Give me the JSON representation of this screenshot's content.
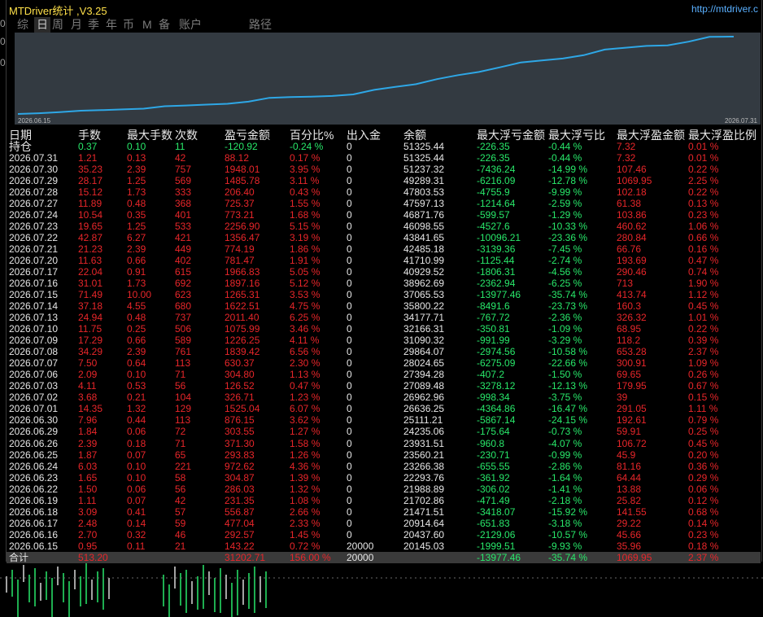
{
  "app": {
    "title": "MTDriver统计 ,V3.25",
    "url": "http://mtdriver.c"
  },
  "tabs": [
    {
      "label": "综",
      "active": false
    },
    {
      "label": "日",
      "active": true
    },
    {
      "label": "周",
      "active": false
    },
    {
      "label": "月",
      "active": false
    },
    {
      "label": "季",
      "active": false
    },
    {
      "label": "年",
      "active": false
    },
    {
      "label": "币",
      "active": false
    },
    {
      "label": "M",
      "active": false
    },
    {
      "label": "备",
      "active": false
    },
    {
      "label": "账户",
      "active": false
    },
    {
      "label": "路径",
      "active": false
    }
  ],
  "equity_chart": {
    "start_label": "2026.06.15",
    "end_label": "2026.07.31",
    "line_color": "#2ea7e6",
    "values": [
      20145.03,
      20437.6,
      20914.64,
      21471.51,
      21702.86,
      21988.89,
      22293.76,
      23266.38,
      23560.21,
      23931.51,
      24235.06,
      25111.21,
      26636.25,
      26962.96,
      27089.48,
      27394.28,
      28024.65,
      29864.07,
      31090.32,
      32166.31,
      34177.71,
      35800.22,
      37065.53,
      38962.69,
      40929.52,
      41710.99,
      42485.18,
      43841.65,
      46098.55,
      46871.76,
      47597.13,
      47803.53,
      49289.31,
      51237.32,
      51325.44
    ]
  },
  "columns": [
    "日期",
    "手数",
    "最大手数",
    "次数",
    "盈亏金额",
    "百分比%",
    "出入金",
    "余额",
    "最大浮亏金额",
    "最大浮亏比",
    "最大浮盈金额",
    "最大浮盈比例"
  ],
  "holding": {
    "date": "持仓",
    "lots": "0.37",
    "max_lots": "0.10",
    "count": "11",
    "pnl": "-120.92",
    "pct": "-0.24 %",
    "inout": "0",
    "balance": "51325.44",
    "max_dd": "-226.35",
    "max_dd_pct": "-0.44 %",
    "max_fp": "7.32",
    "max_fp_pct": "0.01 %"
  },
  "rows": [
    {
      "date": "2026.07.31",
      "lots": "1.21",
      "max_lots": "0.13",
      "count": "42",
      "pnl": "88.12",
      "pct": "0.17 %",
      "inout": "0",
      "balance": "51325.44",
      "max_dd": "-226.35",
      "max_dd_pct": "-0.44 %",
      "max_fp": "7.32",
      "max_fp_pct": "0.01 %"
    },
    {
      "date": "2026.07.30",
      "lots": "35.23",
      "max_lots": "2.39",
      "count": "757",
      "pnl": "1948.01",
      "pct": "3.95 %",
      "inout": "0",
      "balance": "51237.32",
      "max_dd": "-7436.24",
      "max_dd_pct": "-14.99 %",
      "max_fp": "107.46",
      "max_fp_pct": "0.22 %"
    },
    {
      "date": "2026.07.29",
      "lots": "28.17",
      "max_lots": "1.25",
      "count": "569",
      "pnl": "1485.78",
      "pct": "3.11 %",
      "inout": "0",
      "balance": "49289.31",
      "max_dd": "-6216.09",
      "max_dd_pct": "-12.78 %",
      "max_fp": "1069.95",
      "max_fp_pct": "2.25 %"
    },
    {
      "date": "2026.07.28",
      "lots": "15.12",
      "max_lots": "1.73",
      "count": "333",
      "pnl": "206.40",
      "pct": "0.43 %",
      "inout": "0",
      "balance": "47803.53",
      "max_dd": "-4755.9",
      "max_dd_pct": "-9.99 %",
      "max_fp": "102.18",
      "max_fp_pct": "0.22 %"
    },
    {
      "date": "2026.07.27",
      "lots": "11.89",
      "max_lots": "0.48",
      "count": "368",
      "pnl": "725.37",
      "pct": "1.55 %",
      "inout": "0",
      "balance": "47597.13",
      "max_dd": "-1214.64",
      "max_dd_pct": "-2.59 %",
      "max_fp": "61.38",
      "max_fp_pct": "0.13 %"
    },
    {
      "date": "2026.07.24",
      "lots": "10.54",
      "max_lots": "0.35",
      "count": "401",
      "pnl": "773.21",
      "pct": "1.68 %",
      "inout": "0",
      "balance": "46871.76",
      "max_dd": "-599.57",
      "max_dd_pct": "-1.29 %",
      "max_fp": "103.86",
      "max_fp_pct": "0.23 %"
    },
    {
      "date": "2026.07.23",
      "lots": "19.65",
      "max_lots": "1.25",
      "count": "533",
      "pnl": "2256.90",
      "pct": "5.15 %",
      "inout": "0",
      "balance": "46098.55",
      "max_dd": "-4527.6",
      "max_dd_pct": "-10.33 %",
      "max_fp": "460.62",
      "max_fp_pct": "1.06 %"
    },
    {
      "date": "2026.07.22",
      "lots": "42.87",
      "max_lots": "6.27",
      "count": "421",
      "pnl": "1356.47",
      "pct": "3.19 %",
      "inout": "0",
      "balance": "43841.65",
      "max_dd": "-10096.21",
      "max_dd_pct": "-23.36 %",
      "max_fp": "280.84",
      "max_fp_pct": "0.66 %"
    },
    {
      "date": "2026.07.21",
      "lots": "21.23",
      "max_lots": "2.39",
      "count": "449",
      "pnl": "774.19",
      "pct": "1.86 %",
      "inout": "0",
      "balance": "42485.18",
      "max_dd": "-3139.36",
      "max_dd_pct": "-7.45 %",
      "max_fp": "66.76",
      "max_fp_pct": "0.16 %"
    },
    {
      "date": "2026.07.20",
      "lots": "11.63",
      "max_lots": "0.66",
      "count": "402",
      "pnl": "781.47",
      "pct": "1.91 %",
      "inout": "0",
      "balance": "41710.99",
      "max_dd": "-1125.44",
      "max_dd_pct": "-2.74 %",
      "max_fp": "193.69",
      "max_fp_pct": "0.47 %"
    },
    {
      "date": "2026.07.17",
      "lots": "22.04",
      "max_lots": "0.91",
      "count": "615",
      "pnl": "1966.83",
      "pct": "5.05 %",
      "inout": "0",
      "balance": "40929.52",
      "max_dd": "-1806.31",
      "max_dd_pct": "-4.56 %",
      "max_fp": "290.46",
      "max_fp_pct": "0.74 %"
    },
    {
      "date": "2026.07.16",
      "lots": "31.01",
      "max_lots": "1.73",
      "count": "692",
      "pnl": "1897.16",
      "pct": "5.12 %",
      "inout": "0",
      "balance": "38962.69",
      "max_dd": "-2362.94",
      "max_dd_pct": "-6.25 %",
      "max_fp": "713",
      "max_fp_pct": "1.90 %"
    },
    {
      "date": "2026.07.15",
      "lots": "71.49",
      "max_lots": "10.00",
      "count": "623",
      "pnl": "1265.31",
      "pct": "3.53 %",
      "inout": "0",
      "balance": "37065.53",
      "max_dd": "-13977.46",
      "max_dd_pct": "-35.74 %",
      "max_fp": "413.74",
      "max_fp_pct": "1.12 %"
    },
    {
      "date": "2026.07.14",
      "lots": "37.18",
      "max_lots": "4.55",
      "count": "680",
      "pnl": "1622.51",
      "pct": "4.75 %",
      "inout": "0",
      "balance": "35800.22",
      "max_dd": "-8491.6",
      "max_dd_pct": "-23.73 %",
      "max_fp": "160.3",
      "max_fp_pct": "0.45 %"
    },
    {
      "date": "2026.07.13",
      "lots": "24.94",
      "max_lots": "0.48",
      "count": "737",
      "pnl": "2011.40",
      "pct": "6.25 %",
      "inout": "0",
      "balance": "34177.71",
      "max_dd": "-767.72",
      "max_dd_pct": "-2.36 %",
      "max_fp": "326.32",
      "max_fp_pct": "1.01 %"
    },
    {
      "date": "2026.07.10",
      "lots": "11.75",
      "max_lots": "0.25",
      "count": "506",
      "pnl": "1075.99",
      "pct": "3.46 %",
      "inout": "0",
      "balance": "32166.31",
      "max_dd": "-350.81",
      "max_dd_pct": "-1.09 %",
      "max_fp": "68.95",
      "max_fp_pct": "0.22 %"
    },
    {
      "date": "2026.07.09",
      "lots": "17.29",
      "max_lots": "0.66",
      "count": "589",
      "pnl": "1226.25",
      "pct": "4.11 %",
      "inout": "0",
      "balance": "31090.32",
      "max_dd": "-991.99",
      "max_dd_pct": "-3.29 %",
      "max_fp": "118.2",
      "max_fp_pct": "0.39 %"
    },
    {
      "date": "2026.07.08",
      "lots": "34.29",
      "max_lots": "2.39",
      "count": "761",
      "pnl": "1839.42",
      "pct": "6.56 %",
      "inout": "0",
      "balance": "29864.07",
      "max_dd": "-2974.56",
      "max_dd_pct": "-10.58 %",
      "max_fp": "653.28",
      "max_fp_pct": "2.37 %"
    },
    {
      "date": "2026.07.07",
      "lots": "7.50",
      "max_lots": "0.64",
      "count": "113",
      "pnl": "630.37",
      "pct": "2.30 %",
      "inout": "0",
      "balance": "28024.65",
      "max_dd": "-6275.09",
      "max_dd_pct": "-22.66 %",
      "max_fp": "300.91",
      "max_fp_pct": "1.09 %"
    },
    {
      "date": "2026.07.06",
      "lots": "2.09",
      "max_lots": "0.10",
      "count": "71",
      "pnl": "304.80",
      "pct": "1.13 %",
      "inout": "0",
      "balance": "27394.28",
      "max_dd": "-407.2",
      "max_dd_pct": "-1.50 %",
      "max_fp": "69.65",
      "max_fp_pct": "0.26 %"
    },
    {
      "date": "2026.07.03",
      "lots": "4.11",
      "max_lots": "0.53",
      "count": "56",
      "pnl": "126.52",
      "pct": "0.47 %",
      "inout": "0",
      "balance": "27089.48",
      "max_dd": "-3278.12",
      "max_dd_pct": "-12.13 %",
      "max_fp": "179.95",
      "max_fp_pct": "0.67 %"
    },
    {
      "date": "2026.07.02",
      "lots": "3.68",
      "max_lots": "0.21",
      "count": "104",
      "pnl": "326.71",
      "pct": "1.23 %",
      "inout": "0",
      "balance": "26962.96",
      "max_dd": "-998.34",
      "max_dd_pct": "-3.75 %",
      "max_fp": "39",
      "max_fp_pct": "0.15 %"
    },
    {
      "date": "2026.07.01",
      "lots": "14.35",
      "max_lots": "1.32",
      "count": "129",
      "pnl": "1525.04",
      "pct": "6.07 %",
      "inout": "0",
      "balance": "26636.25",
      "max_dd": "-4364.86",
      "max_dd_pct": "-16.47 %",
      "max_fp": "291.05",
      "max_fp_pct": "1.11 %"
    },
    {
      "date": "2026.06.30",
      "lots": "7.96",
      "max_lots": "0.44",
      "count": "113",
      "pnl": "876.15",
      "pct": "3.62 %",
      "inout": "0",
      "balance": "25111.21",
      "max_dd": "-5867.14",
      "max_dd_pct": "-24.15 %",
      "max_fp": "192.61",
      "max_fp_pct": "0.79 %"
    },
    {
      "date": "2026.06.29",
      "lots": "1.84",
      "max_lots": "0.06",
      "count": "72",
      "pnl": "303.55",
      "pct": "1.27 %",
      "inout": "0",
      "balance": "24235.06",
      "max_dd": "-175.64",
      "max_dd_pct": "-0.73 %",
      "max_fp": "59.91",
      "max_fp_pct": "0.25 %"
    },
    {
      "date": "2026.06.26",
      "lots": "2.39",
      "max_lots": "0.18",
      "count": "71",
      "pnl": "371.30",
      "pct": "1.58 %",
      "inout": "0",
      "balance": "23931.51",
      "max_dd": "-960.8",
      "max_dd_pct": "-4.07 %",
      "max_fp": "106.72",
      "max_fp_pct": "0.45 %"
    },
    {
      "date": "2026.06.25",
      "lots": "1.87",
      "max_lots": "0.07",
      "count": "65",
      "pnl": "293.83",
      "pct": "1.26 %",
      "inout": "0",
      "balance": "23560.21",
      "max_dd": "-230.71",
      "max_dd_pct": "-0.99 %",
      "max_fp": "45.9",
      "max_fp_pct": "0.20 %"
    },
    {
      "date": "2026.06.24",
      "lots": "6.03",
      "max_lots": "0.10",
      "count": "221",
      "pnl": "972.62",
      "pct": "4.36 %",
      "inout": "0",
      "balance": "23266.38",
      "max_dd": "-655.55",
      "max_dd_pct": "-2.86 %",
      "max_fp": "81.16",
      "max_fp_pct": "0.36 %"
    },
    {
      "date": "2026.06.23",
      "lots": "1.65",
      "max_lots": "0.10",
      "count": "58",
      "pnl": "304.87",
      "pct": "1.39 %",
      "inout": "0",
      "balance": "22293.76",
      "max_dd": "-361.92",
      "max_dd_pct": "-1.64 %",
      "max_fp": "64.44",
      "max_fp_pct": "0.29 %"
    },
    {
      "date": "2026.06.22",
      "lots": "1.50",
      "max_lots": "0.06",
      "count": "56",
      "pnl": "286.03",
      "pct": "1.32 %",
      "inout": "0",
      "balance": "21988.89",
      "max_dd": "-306.02",
      "max_dd_pct": "-1.41 %",
      "max_fp": "13.88",
      "max_fp_pct": "0.06 %"
    },
    {
      "date": "2026.06.19",
      "lots": "1.11",
      "max_lots": "0.07",
      "count": "42",
      "pnl": "231.35",
      "pct": "1.08 %",
      "inout": "0",
      "balance": "21702.86",
      "max_dd": "-471.49",
      "max_dd_pct": "-2.18 %",
      "max_fp": "25.82",
      "max_fp_pct": "0.12 %"
    },
    {
      "date": "2026.06.18",
      "lots": "3.09",
      "max_lots": "0.41",
      "count": "57",
      "pnl": "556.87",
      "pct": "2.66 %",
      "inout": "0",
      "balance": "21471.51",
      "max_dd": "-3418.07",
      "max_dd_pct": "-15.92 %",
      "max_fp": "141.55",
      "max_fp_pct": "0.68 %"
    },
    {
      "date": "2026.06.17",
      "lots": "2.48",
      "max_lots": "0.14",
      "count": "59",
      "pnl": "477.04",
      "pct": "2.33 %",
      "inout": "0",
      "balance": "20914.64",
      "max_dd": "-651.83",
      "max_dd_pct": "-3.18 %",
      "max_fp": "29.22",
      "max_fp_pct": "0.14 %"
    },
    {
      "date": "2026.06.16",
      "lots": "2.70",
      "max_lots": "0.32",
      "count": "46",
      "pnl": "292.57",
      "pct": "1.45 %",
      "inout": "0",
      "balance": "20437.60",
      "max_dd": "-2129.06",
      "max_dd_pct": "-10.57 %",
      "max_fp": "45.66",
      "max_fp_pct": "0.23 %"
    },
    {
      "date": "2026.06.15",
      "lots": "0.95",
      "max_lots": "0.11",
      "count": "21",
      "pnl": "143.22",
      "pct": "0.72 %",
      "inout": "20000",
      "balance": "20145.03",
      "max_dd": "-1999.51",
      "max_dd_pct": "-9.93 %",
      "max_fp": "35.96",
      "max_fp_pct": "0.18 %"
    }
  ],
  "total": {
    "date": "合计",
    "lots": "513.20",
    "max_lots": "",
    "count": "",
    "pnl": "31202.71",
    "pct": "156.00 %",
    "inout": "20000",
    "balance": "",
    "max_dd": "-13977.46",
    "max_dd_pct": "-35.74 %",
    "max_fp": "1069.95",
    "max_fp_pct": "2.37 %"
  },
  "colors": {
    "positive": "#28e86a",
    "negative": "#e8262a",
    "neutral": "#e6e6e6",
    "line": "#2ea7e6"
  }
}
